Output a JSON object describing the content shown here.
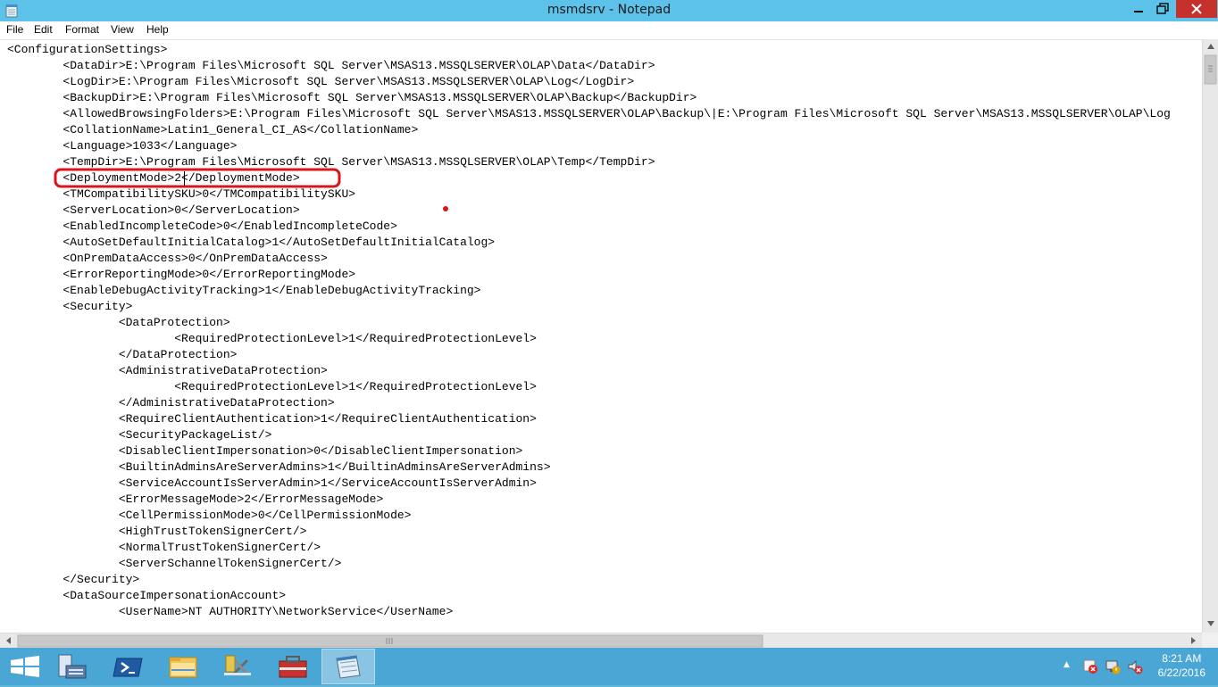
{
  "window": {
    "title": "msmdsrv - Notepad",
    "min_glyph": "─",
    "restore_glyph": "❐",
    "close_glyph": "✖"
  },
  "menu": {
    "file": "File",
    "edit": "Edit",
    "format": "Format",
    "view": "View",
    "help": "Help"
  },
  "editor": {
    "lines": [
      "<ConfigurationSettings>",
      "        <DataDir>E:\\Program Files\\Microsoft SQL Server\\MSAS13.MSSQLSERVER\\OLAP\\Data</DataDir>",
      "        <LogDir>E:\\Program Files\\Microsoft SQL Server\\MSAS13.MSSQLSERVER\\OLAP\\Log</LogDir>",
      "        <BackupDir>E:\\Program Files\\Microsoft SQL Server\\MSAS13.MSSQLSERVER\\OLAP\\Backup</BackupDir>",
      "        <AllowedBrowsingFolders>E:\\Program Files\\Microsoft SQL Server\\MSAS13.MSSQLSERVER\\OLAP\\Backup\\|E:\\Program Files\\Microsoft SQL Server\\MSAS13.MSSQLSERVER\\OLAP\\Log",
      "        <CollationName>Latin1_General_CI_AS</CollationName>",
      "        <Language>1033</Language>",
      "        <TempDir>E:\\Program Files\\Microsoft SQL Server\\MSAS13.MSSQLSERVER\\OLAP\\Temp</TempDir>",
      "        <DeploymentMode>2</DeploymentMode>",
      "        <TMCompatibilitySKU>0</TMCompatibilitySKU>",
      "        <ServerLocation>0</ServerLocation>",
      "        <EnabledIncompleteCode>0</EnabledIncompleteCode>",
      "        <AutoSetDefaultInitialCatalog>1</AutoSetDefaultInitialCatalog>",
      "        <OnPremDataAccess>0</OnPremDataAccess>",
      "        <ErrorReportingMode>0</ErrorReportingMode>",
      "        <EnableDebugActivityTracking>1</EnableDebugActivityTracking>",
      "        <Security>",
      "                <DataProtection>",
      "                        <RequiredProtectionLevel>1</RequiredProtectionLevel>",
      "                </DataProtection>",
      "                <AdministrativeDataProtection>",
      "                        <RequiredProtectionLevel>1</RequiredProtectionLevel>",
      "                </AdministrativeDataProtection>",
      "                <RequireClientAuthentication>1</RequireClientAuthentication>",
      "                <SecurityPackageList/>",
      "                <DisableClientImpersonation>0</DisableClientImpersonation>",
      "                <BuiltinAdminsAreServerAdmins>1</BuiltinAdminsAreServerAdmins>",
      "                <ServiceAccountIsServerAdmin>1</ServiceAccountIsServerAdmin>",
      "                <ErrorMessageMode>2</ErrorMessageMode>",
      "                <CellPermissionMode>0</CellPermissionMode>",
      "                <HighTrustTokenSignerCert/>",
      "                <NormalTrustTokenSignerCert/>",
      "                <ServerSchannelTokenSignerCert/>",
      "        </Security>",
      "        <DataSourceImpersonationAccount>",
      "                <UserName>NT AUTHORITY\\NetworkService</UserName>"
    ]
  },
  "highlight_color": "#d9141b",
  "taskbar": {
    "pinned": [
      "windows-start-icon",
      "server-manager-icon",
      "powershell-icon",
      "file-explorer-icon",
      "tools-icon",
      "toolbox-icon",
      "notepad-icon"
    ],
    "tray": {
      "up_arrow": "▲",
      "time": "8:21 AM",
      "date": "6/22/2016"
    }
  }
}
